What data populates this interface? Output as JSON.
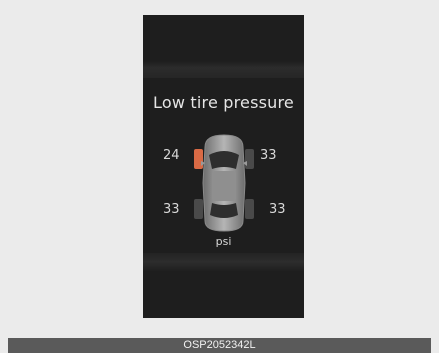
{
  "warning": {
    "title": "Low tire pressure",
    "unit": "psi",
    "tires": {
      "front_left": "24",
      "front_right": "33",
      "rear_left": "33",
      "rear_right": "33"
    },
    "low_tire_color": "#d96a45"
  },
  "caption": "OSP2052342L"
}
